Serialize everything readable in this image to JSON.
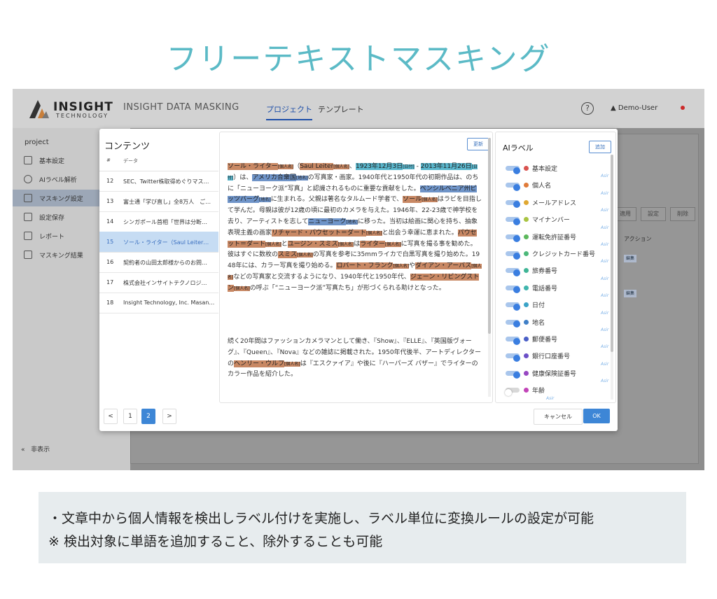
{
  "page_title": "フリーテキストマスキング",
  "app": {
    "logo_name": "INSIGHT",
    "logo_sub": "TECHNOLOGY",
    "name": "INSIGHT DATA MASKING",
    "nav": [
      "プロジェクト",
      "テンプレート"
    ],
    "user": "Demo-User",
    "help_icon": "?"
  },
  "sidebar": {
    "title": "project",
    "items": [
      {
        "label": "基本設定",
        "icon": "doc-icon"
      },
      {
        "label": "AIラベル解析",
        "icon": "brain-icon"
      },
      {
        "label": "マスキング設定",
        "icon": "table-icon",
        "active": true
      },
      {
        "label": "設定保存",
        "icon": "save-icon"
      },
      {
        "label": "レポート",
        "icon": "report-icon"
      },
      {
        "label": "マスキング結果",
        "icon": "box-icon"
      }
    ],
    "hide_label": "非表示"
  },
  "background": {
    "buttons": [
      "適用",
      "設定",
      "削除"
    ],
    "action_header": "アクション",
    "edit_label": "編集"
  },
  "contents": {
    "title": "コンテンツ",
    "col_num": "#",
    "col_data": "データ",
    "rows": [
      {
        "num": "12",
        "text": "SEC、Twitter株取得めぐりマス…"
      },
      {
        "num": "13",
        "text": "富士通「学び直し」全8万人　ご…"
      },
      {
        "num": "14",
        "text": "シンガポール首相「世界は分断…"
      },
      {
        "num": "15",
        "text": "ソール・ライター（Saul Leiter…",
        "selected": true
      },
      {
        "num": "16",
        "text": "契約者の山田太郎様からのお問…"
      },
      {
        "num": "17",
        "text": "株式会社インサイトテクノロジ…"
      },
      {
        "num": "18",
        "text": "Insight Technology, Inc. Masan…"
      }
    ],
    "pager": {
      "prev": "<",
      "pages": [
        "1",
        "2"
      ],
      "current": "2",
      "next": ">"
    }
  },
  "text_pane": {
    "update_label": "更新",
    "segments1": [
      {
        "t": "ソール・ライター",
        "h": "o"
      },
      {
        "t": "[個人名]",
        "h": "ot"
      },
      {
        "t": "（"
      },
      {
        "t": "Saul Leiter",
        "h": "o"
      },
      {
        "t": "[個人名]",
        "h": "ot"
      },
      {
        "t": "、"
      },
      {
        "t": "1923年12月3日",
        "h": "b"
      },
      {
        "t": "[日付]",
        "h": "bt"
      },
      {
        "t": " - "
      },
      {
        "t": "2013年11月26日",
        "h": "b"
      },
      {
        "t": "[日付]",
        "h": "bt"
      },
      {
        "t": "）は、"
      },
      {
        "t": "アメリカ合衆国",
        "h": "d"
      },
      {
        "t": "[地名]",
        "h": "dt"
      },
      {
        "t": "の写真家・画家。1940年代と1950年代の初期作品は、のちに「ニューヨーク派”写真」と認識されるものに重要な貢献をした。"
      },
      {
        "t": "ペンシルベニア州ピッツバーグ",
        "h": "d"
      },
      {
        "t": "[地名]",
        "h": "dt"
      },
      {
        "t": "に生まれる。父親は著名なタルムード学者で、"
      },
      {
        "t": "ソール",
        "h": "o"
      },
      {
        "t": "[個人名]",
        "h": "ot"
      },
      {
        "t": "はラビを目指して学んだ。母親は彼が12歳の頃に最初のカメラを与えた。1946年、22-23歳で神学校を去り、アーティストを志して"
      },
      {
        "t": "ニューヨーク",
        "h": "d"
      },
      {
        "t": "[地名]",
        "h": "dt"
      },
      {
        "t": "に移った。当初は絵画に関心を持ち、抽象表現主義の画家"
      },
      {
        "t": "リチャード・パウセット＝ダート",
        "h": "o"
      },
      {
        "t": "[個人名]",
        "h": "ot"
      },
      {
        "t": "と出会う幸運に恵まれた。"
      },
      {
        "t": "パウセット＝ダート",
        "h": "o"
      },
      {
        "t": "[個人名]",
        "h": "ot"
      },
      {
        "t": "と"
      },
      {
        "t": "ユージン・スミス",
        "h": "o"
      },
      {
        "t": "[個人名]",
        "h": "ot"
      },
      {
        "t": "は"
      },
      {
        "t": "ライター",
        "h": "o"
      },
      {
        "t": "[個人名]",
        "h": "ot"
      },
      {
        "t": "に写真を撮る事を勧めた。彼はすぐに数枚の"
      },
      {
        "t": "スミス",
        "h": "o"
      },
      {
        "t": "[個人名]",
        "h": "ot"
      },
      {
        "t": "の写真を参考に35mmライカで白黒写真を撮り始めた。1948年には、カラー写真を撮り始める。"
      },
      {
        "t": "ロバート・フランク",
        "h": "o"
      },
      {
        "t": "[個人名]",
        "h": "ot"
      },
      {
        "t": "や"
      },
      {
        "t": "ダイアン・アーバス",
        "h": "o"
      },
      {
        "t": "[個人名]",
        "h": "ot"
      },
      {
        "t": "などの写真家と交流するようになり、1940年代と1950年代、"
      },
      {
        "t": "ジェーン・リビングストン",
        "h": "o"
      },
      {
        "t": "[個人名]",
        "h": "ot"
      },
      {
        "t": "の呼ぶ「“ニューヨーク派”写真たち」が形づくられる助けとなった。"
      }
    ],
    "segments2": [
      {
        "t": "続く20年間はファッションカメラマンとして働き、『Show』、『ELLE』、『英国版ヴォーグ』、『Queen』、『Nova』などの雑誌に掲載された。1950年代後半、アートディレクターの"
      },
      {
        "t": "ヘンリー・ウルフ",
        "h": "o"
      },
      {
        "t": "[個人名]",
        "h": "ot"
      },
      {
        "t": "は『エスクァイア』や後に『ハーパーズ バザー』でライターのカラー作品を紹介した。"
      }
    ]
  },
  "ai_labels": {
    "title": "AIラベル",
    "add_label": "追加",
    "asir": "Asir",
    "items": [
      {
        "name": "基本設定",
        "color": "#d9534f",
        "on": true
      },
      {
        "name": "個人名",
        "color": "#e07b39",
        "on": true
      },
      {
        "name": "メールアドレス",
        "color": "#e0a832",
        "on": true
      },
      {
        "name": "マイナンバー",
        "color": "#a9c442",
        "on": true
      },
      {
        "name": "運転免許証番号",
        "color": "#5cb85c",
        "on": true
      },
      {
        "name": "クレジットカード番号",
        "color": "#4cb87a",
        "on": true
      },
      {
        "name": "旅券番号",
        "color": "#3fb596",
        "on": true
      },
      {
        "name": "電話番号",
        "color": "#3fb5ad",
        "on": true
      },
      {
        "name": "日付",
        "color": "#3aa3c7",
        "on": true
      },
      {
        "name": "地名",
        "color": "#3f7fc7",
        "on": true
      },
      {
        "name": "郵便番号",
        "color": "#4a5fc7",
        "on": true
      },
      {
        "name": "銀行口座番号",
        "color": "#6b4fc7",
        "on": true
      },
      {
        "name": "健康保険証番号",
        "color": "#9747c2",
        "on": true
      },
      {
        "name": "年齢",
        "color": "#c244b8",
        "on": false
      }
    ]
  },
  "footer": {
    "cancel": "キャンセル",
    "ok": "OK"
  },
  "caption": {
    "line1": "・文章中から個人情報を検出しラベル付けを実施し、ラベル単位に変換ルールの設定が可能",
    "line2": "※ 検出対象に単語を追加すること、除外することも可能"
  }
}
